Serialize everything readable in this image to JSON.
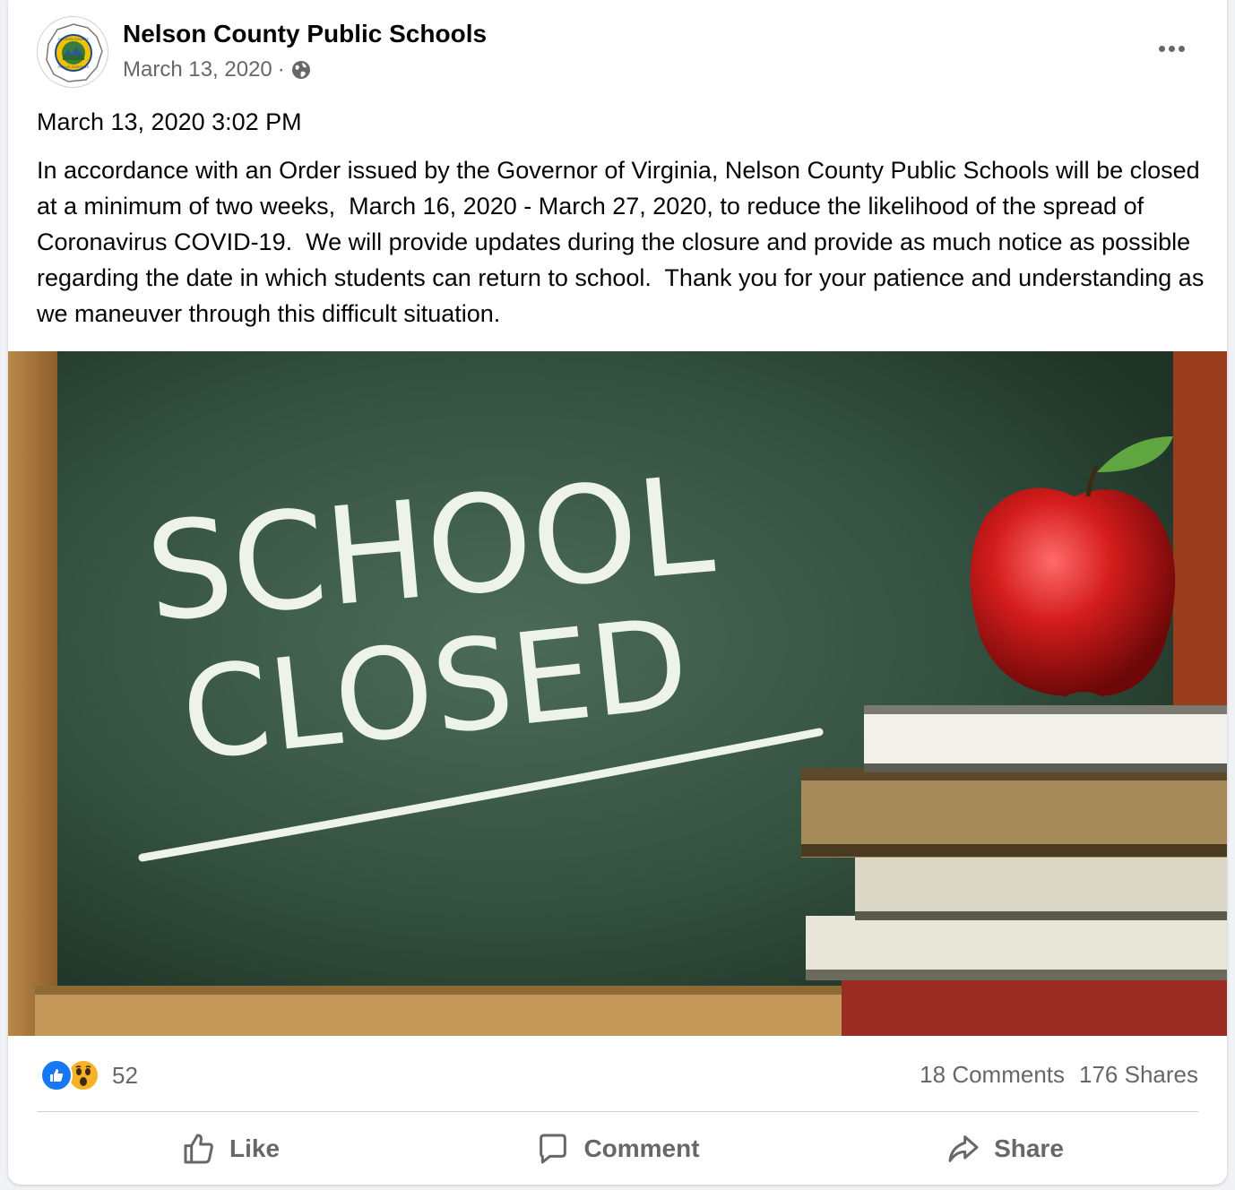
{
  "post": {
    "page_name": "Nelson County Public Schools",
    "date": "March 13, 2020",
    "separator": "·",
    "privacy_icon": "globe-icon",
    "more_icon": "more-options-icon",
    "timestamp_line": "March 13, 2020 3:02 PM",
    "body": "In accordance with an Order issued by the Governor of Virginia, Nelson County Public Schools will be closed at a minimum of two weeks,  March 16, 2020 - March 27, 2020, to reduce the likelihood of the spread of Coronavirus COVID-19.  We will provide updates during the closure and provide as much notice as possible regarding the date in which students can return to school.  Thank you for your patience and understanding as we maneuver through this difficult situation."
  },
  "avatar": {
    "logo_text_top": "NELSON COUNTY",
    "logo_text_bottom": "PUBLIC SCHOOLS"
  },
  "image": {
    "line1": "SCHOOL",
    "line2": "CLOSED"
  },
  "stats": {
    "reaction_icons": [
      "like-reaction-icon",
      "wow-reaction-icon"
    ],
    "reaction_count": "52",
    "comments": "18 Comments",
    "shares": "176 Shares"
  },
  "actions": {
    "like": "Like",
    "comment": "Comment",
    "share": "Share"
  },
  "colors": {
    "accent": "#1877f2",
    "wow": "#f7b125",
    "secondary_text": "#65676b",
    "chalkboard": "#2f4a38"
  }
}
